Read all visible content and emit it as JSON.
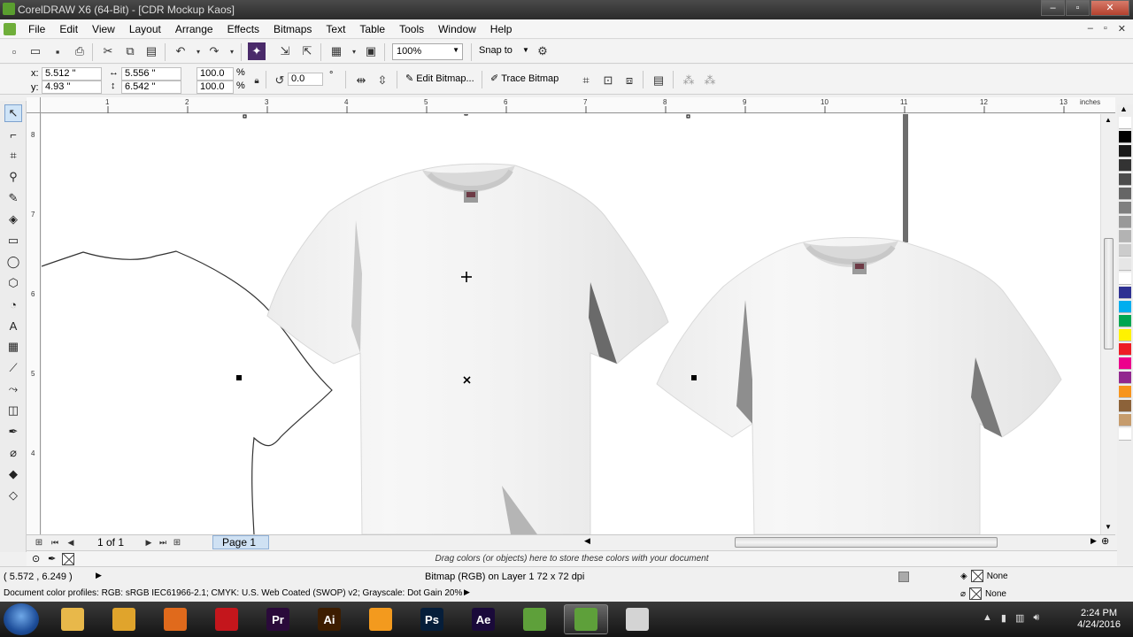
{
  "window": {
    "title": "CorelDRAW X6 (64-Bit) - [CDR Mockup Kaos]",
    "minimize": "–",
    "maximize": "▫",
    "close": "✕"
  },
  "menu": {
    "items": [
      "File",
      "Edit",
      "View",
      "Layout",
      "Arrange",
      "Effects",
      "Bitmaps",
      "Text",
      "Table",
      "Tools",
      "Window",
      "Help"
    ],
    "doc_controls": [
      "–",
      "▫",
      "✕"
    ]
  },
  "standard_toolbar": {
    "zoom": "100%",
    "snap_to": "Snap to"
  },
  "property_bar": {
    "x_label": "x:",
    "x_value": "5.512 \"",
    "y_label": "y:",
    "y_value": "4.93 \"",
    "width_value": "5.556 \"",
    "height_value": "6.542 \"",
    "scale_w": "100.0",
    "scale_h": "100.0",
    "percent": "%",
    "rotation": "0.0",
    "degree": "°",
    "edit_bitmap": "Edit Bitmap...",
    "trace_bitmap": "Trace Bitmap"
  },
  "ruler": {
    "units": "inches",
    "h_ticks": [
      "1",
      "2",
      "3",
      "4",
      "5",
      "6",
      "7",
      "8",
      "9",
      "10",
      "11",
      "12",
      "13"
    ],
    "v_ticks": [
      "8",
      "7",
      "6",
      "5",
      "4"
    ]
  },
  "page_nav": {
    "count": "1 of 1",
    "page_tab": "Page 1"
  },
  "doc_palette_hint": "Drag colors (or objects) here to store these colors with your document",
  "status": {
    "coords": "( 5.572 , 6.249 )",
    "object_info": "Bitmap (RGB) on Layer 1 72 x 72 dpi",
    "color_profiles": "Document color profiles: RGB: sRGB IEC61966-2.1; CMYK: U.S. Web Coated (SWOP) v2; Grayscale: Dot Gain 20%",
    "fill": "None",
    "outline": "None"
  },
  "palette_colors": [
    "#ffffff",
    "#000000",
    "#1a1a1a",
    "#333333",
    "#4d4d4d",
    "#666666",
    "#808080",
    "#999999",
    "#b3b3b3",
    "#cccccc",
    "#e6e6e6",
    "#ffffff",
    "#2e3192",
    "#00aeef",
    "#00a651",
    "#fff200",
    "#ed1c24",
    "#ec008c",
    "#92278f",
    "#f7941d",
    "#8c6239",
    "#c69c6d",
    "#ffffff"
  ],
  "taskbar": {
    "apps": [
      {
        "name": "explorer",
        "label": "",
        "color": "#e8b84a"
      },
      {
        "name": "chrome-like",
        "label": "",
        "color": "#e0a42c"
      },
      {
        "name": "firefox",
        "label": "",
        "color": "#e06a1c"
      },
      {
        "name": "acrobat",
        "label": "",
        "color": "#c4161c"
      },
      {
        "name": "premiere",
        "label": "Pr",
        "color": "#2a0a3a"
      },
      {
        "name": "illustrator",
        "label": "Ai",
        "color": "#3d1d00"
      },
      {
        "name": "orange-app",
        "label": "",
        "color": "#f39a1e"
      },
      {
        "name": "photoshop",
        "label": "Ps",
        "color": "#061e3a"
      },
      {
        "name": "after-effects",
        "label": "Ae",
        "color": "#1a0a3a"
      },
      {
        "name": "corel-1",
        "label": "",
        "color": "#5ea03a"
      },
      {
        "name": "corel-2",
        "label": "",
        "color": "#5ea03a"
      },
      {
        "name": "folder",
        "label": "",
        "color": "#d4d4d4"
      }
    ],
    "time": "2:24 PM",
    "date": "4/24/2016"
  }
}
